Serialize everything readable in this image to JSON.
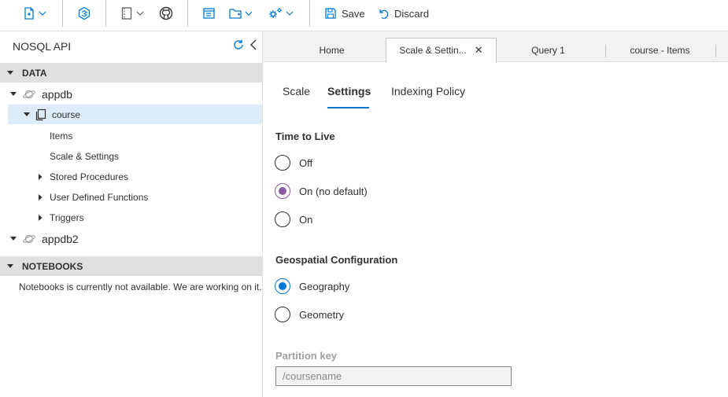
{
  "toolbar": {
    "save_label": "Save",
    "discard_label": "Discard"
  },
  "sidebar": {
    "title": "NOSQL API",
    "data_section": "DATA",
    "databases": [
      {
        "label": "appdb"
      },
      {
        "label": "appdb2"
      }
    ],
    "container": {
      "label": "course",
      "items": [
        {
          "label": "Items"
        },
        {
          "label": "Scale & Settings"
        },
        {
          "label": "Stored Procedures"
        },
        {
          "label": "User Defined Functions"
        },
        {
          "label": "Triggers"
        }
      ]
    },
    "notebooks_section": "NOTEBOOKS",
    "notebooks_message": "Notebooks is currently not available. We are working on it."
  },
  "tabs": [
    {
      "label": "Home"
    },
    {
      "label": "Scale & Settin..."
    },
    {
      "label": "Query 1"
    },
    {
      "label": "course - Items"
    }
  ],
  "pivots": [
    {
      "label": "Scale"
    },
    {
      "label": "Settings"
    },
    {
      "label": "Indexing Policy"
    }
  ],
  "ttl": {
    "title": "Time to Live",
    "options": [
      {
        "label": "Off"
      },
      {
        "label": "On (no default)"
      },
      {
        "label": "On"
      }
    ],
    "selected": "On (no default)"
  },
  "geo": {
    "title": "Geospatial Configuration",
    "options": [
      {
        "label": "Geography"
      },
      {
        "label": "Geometry"
      }
    ],
    "selected": "Geography"
  },
  "partition_key": {
    "label": "Partition key",
    "value": "/coursename"
  },
  "colors": {
    "accent": "#0078d4",
    "radio_selected_ttl": "#8c5a9e",
    "section_bg": "#e1dfdd",
    "selected_row_bg": "#deecf9"
  }
}
